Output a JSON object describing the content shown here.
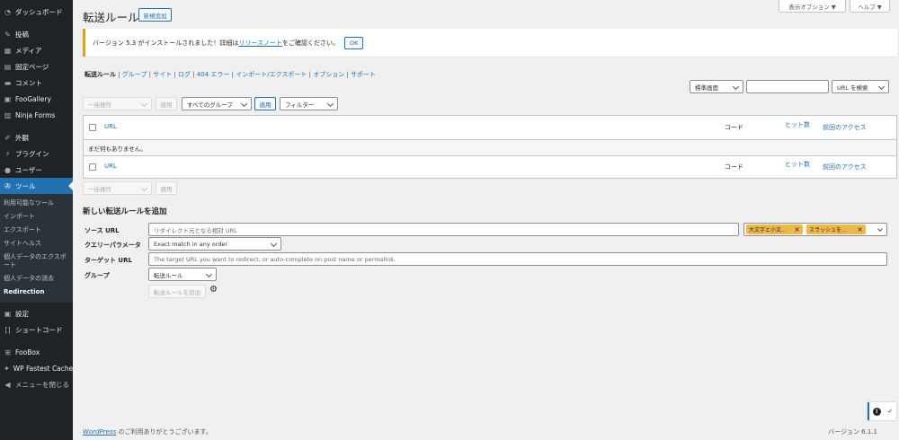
{
  "sidebar": {
    "items": [
      {
        "label": "ダッシュボード",
        "icon": "dashboard-icon"
      },
      {
        "label": "投稿",
        "icon": "pin-icon"
      },
      {
        "label": "メディア",
        "icon": "media-icon"
      },
      {
        "label": "固定ページ",
        "icon": "page-icon"
      },
      {
        "label": "コメント",
        "icon": "comment-icon"
      },
      {
        "label": "FooGallery",
        "icon": "gallery-icon"
      },
      {
        "label": "Ninja Forms",
        "icon": "forms-icon"
      },
      {
        "label": "外観",
        "icon": "brush-icon"
      },
      {
        "label": "プラグイン",
        "icon": "plugin-icon"
      },
      {
        "label": "ユーザー",
        "icon": "user-icon"
      },
      {
        "label": "ツール",
        "icon": "wrench-icon"
      }
    ],
    "submenu": [
      "利用可能なツール",
      "インポート",
      "エクスポート",
      "サイトヘルス",
      "個人データのエクスポート",
      "個人データの消去",
      "Redirection"
    ],
    "items2": [
      {
        "label": "設定",
        "icon": "settings-icon"
      },
      {
        "label": "ショートコード",
        "icon": "shortcode-icon"
      },
      {
        "label": "FooBox",
        "icon": "foobox-icon"
      },
      {
        "label": "WP Fastest Cache",
        "icon": "cache-icon"
      },
      {
        "label": "メニューを閉じる",
        "icon": "collapse-icon"
      }
    ]
  },
  "header": {
    "title": "転送ルール",
    "add_new": "新規追加",
    "screen_options": "表示オプション ▼",
    "help": "ヘルプ ▼"
  },
  "notice": {
    "text_before": "バージョン 5.3 がインストールされました！詳細は",
    "link": "リリースノート",
    "text_after": "をご確認ください。",
    "ok": "OK"
  },
  "subnav": {
    "items": [
      "転送ルール",
      "グループ",
      "サイト",
      "ログ",
      "404 エラー",
      "インポート/エクスポート",
      "オプション",
      "サポート"
    ],
    "separator": " | "
  },
  "search": {
    "mode": "標準画面",
    "button": "URL を検索"
  },
  "toolbar": {
    "bulk": "一括操作",
    "apply": "適用",
    "groups": "すべてのグループ",
    "apply2": "適用",
    "filter": "フィルター"
  },
  "table": {
    "col_url": "URL",
    "col_code": "コード",
    "col_hits": "ヒット数",
    "col_last": "前回のアクセス",
    "empty": "まだ何もありません。"
  },
  "bottom_toolbar": {
    "bulk": "一括操作",
    "apply": "適用"
  },
  "form": {
    "title": "新しい転送ルールを追加",
    "source_label": "ソース URL",
    "source_placeholder": "リダイレクト元となる相対 URL",
    "tag1": "大文字と小文...",
    "tag2": "スラッシュを...",
    "query_label": "クエリーパラメータ",
    "query_value": "Exact match in any order",
    "target_label": "ターゲット URL",
    "target_placeholder": "The target URL you want to redirect, or auto-complete on post name or permalink.",
    "group_label": "グループ",
    "group_value": "転送ルール",
    "submit": "転送ルールを追加"
  },
  "footer": {
    "wp_link": "WordPress",
    "thanks": " のご利用ありがとうございます。",
    "version": "バージョン 6.1.1"
  },
  "colors": {
    "accent": "#2271b1",
    "sidebar": "#1d2327",
    "notice": "#dba617",
    "tag": "#f0b849"
  }
}
